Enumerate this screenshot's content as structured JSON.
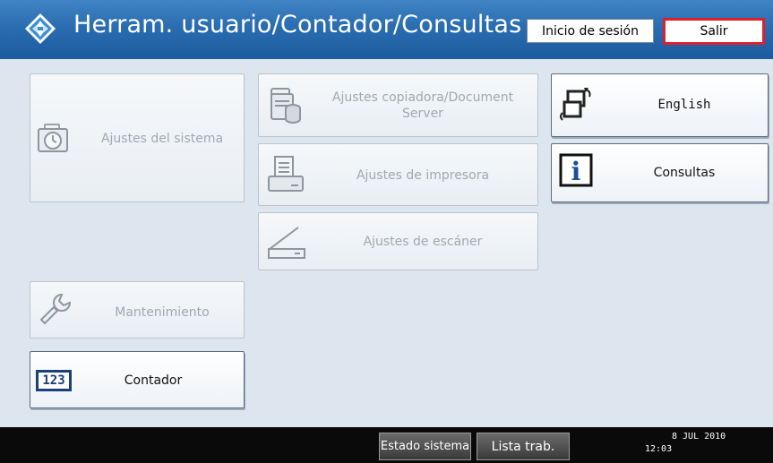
{
  "header": {
    "title": "Herram. usuario/Contador/Consultas",
    "login_label": "Inicio de sesión",
    "logout_label": "Salir",
    "icon": "diamond-arrows-icon"
  },
  "tiles": {
    "system": {
      "label": "Ajustes del sistema",
      "icon": "camera-clock-icon"
    },
    "copier": {
      "label": "Ajustes copiadora/Document Server",
      "icon": "copier-stack-icon"
    },
    "printer": {
      "label": "Ajustes de impresora",
      "icon": "printer-icon"
    },
    "scanner": {
      "label": "Ajustes de escáner",
      "icon": "scanner-icon"
    },
    "english": {
      "label": "English",
      "icon": "language-switch-icon"
    },
    "inquiry": {
      "label": "Consultas",
      "icon": "info-icon"
    },
    "maintenance": {
      "label": "Mantenimiento",
      "icon": "wrench-icon"
    },
    "counter": {
      "label": "Contador",
      "icon": "counter-123-icon",
      "icon_text": "123"
    }
  },
  "statusbar": {
    "system_status_label": "Estado sistema",
    "job_list_label": "Lista trab.",
    "date": "8 JUL  2010",
    "time": "12:03"
  },
  "colors": {
    "header": "#2a6db0",
    "logout_border": "#e01f2a",
    "background": "#dde6ee"
  }
}
